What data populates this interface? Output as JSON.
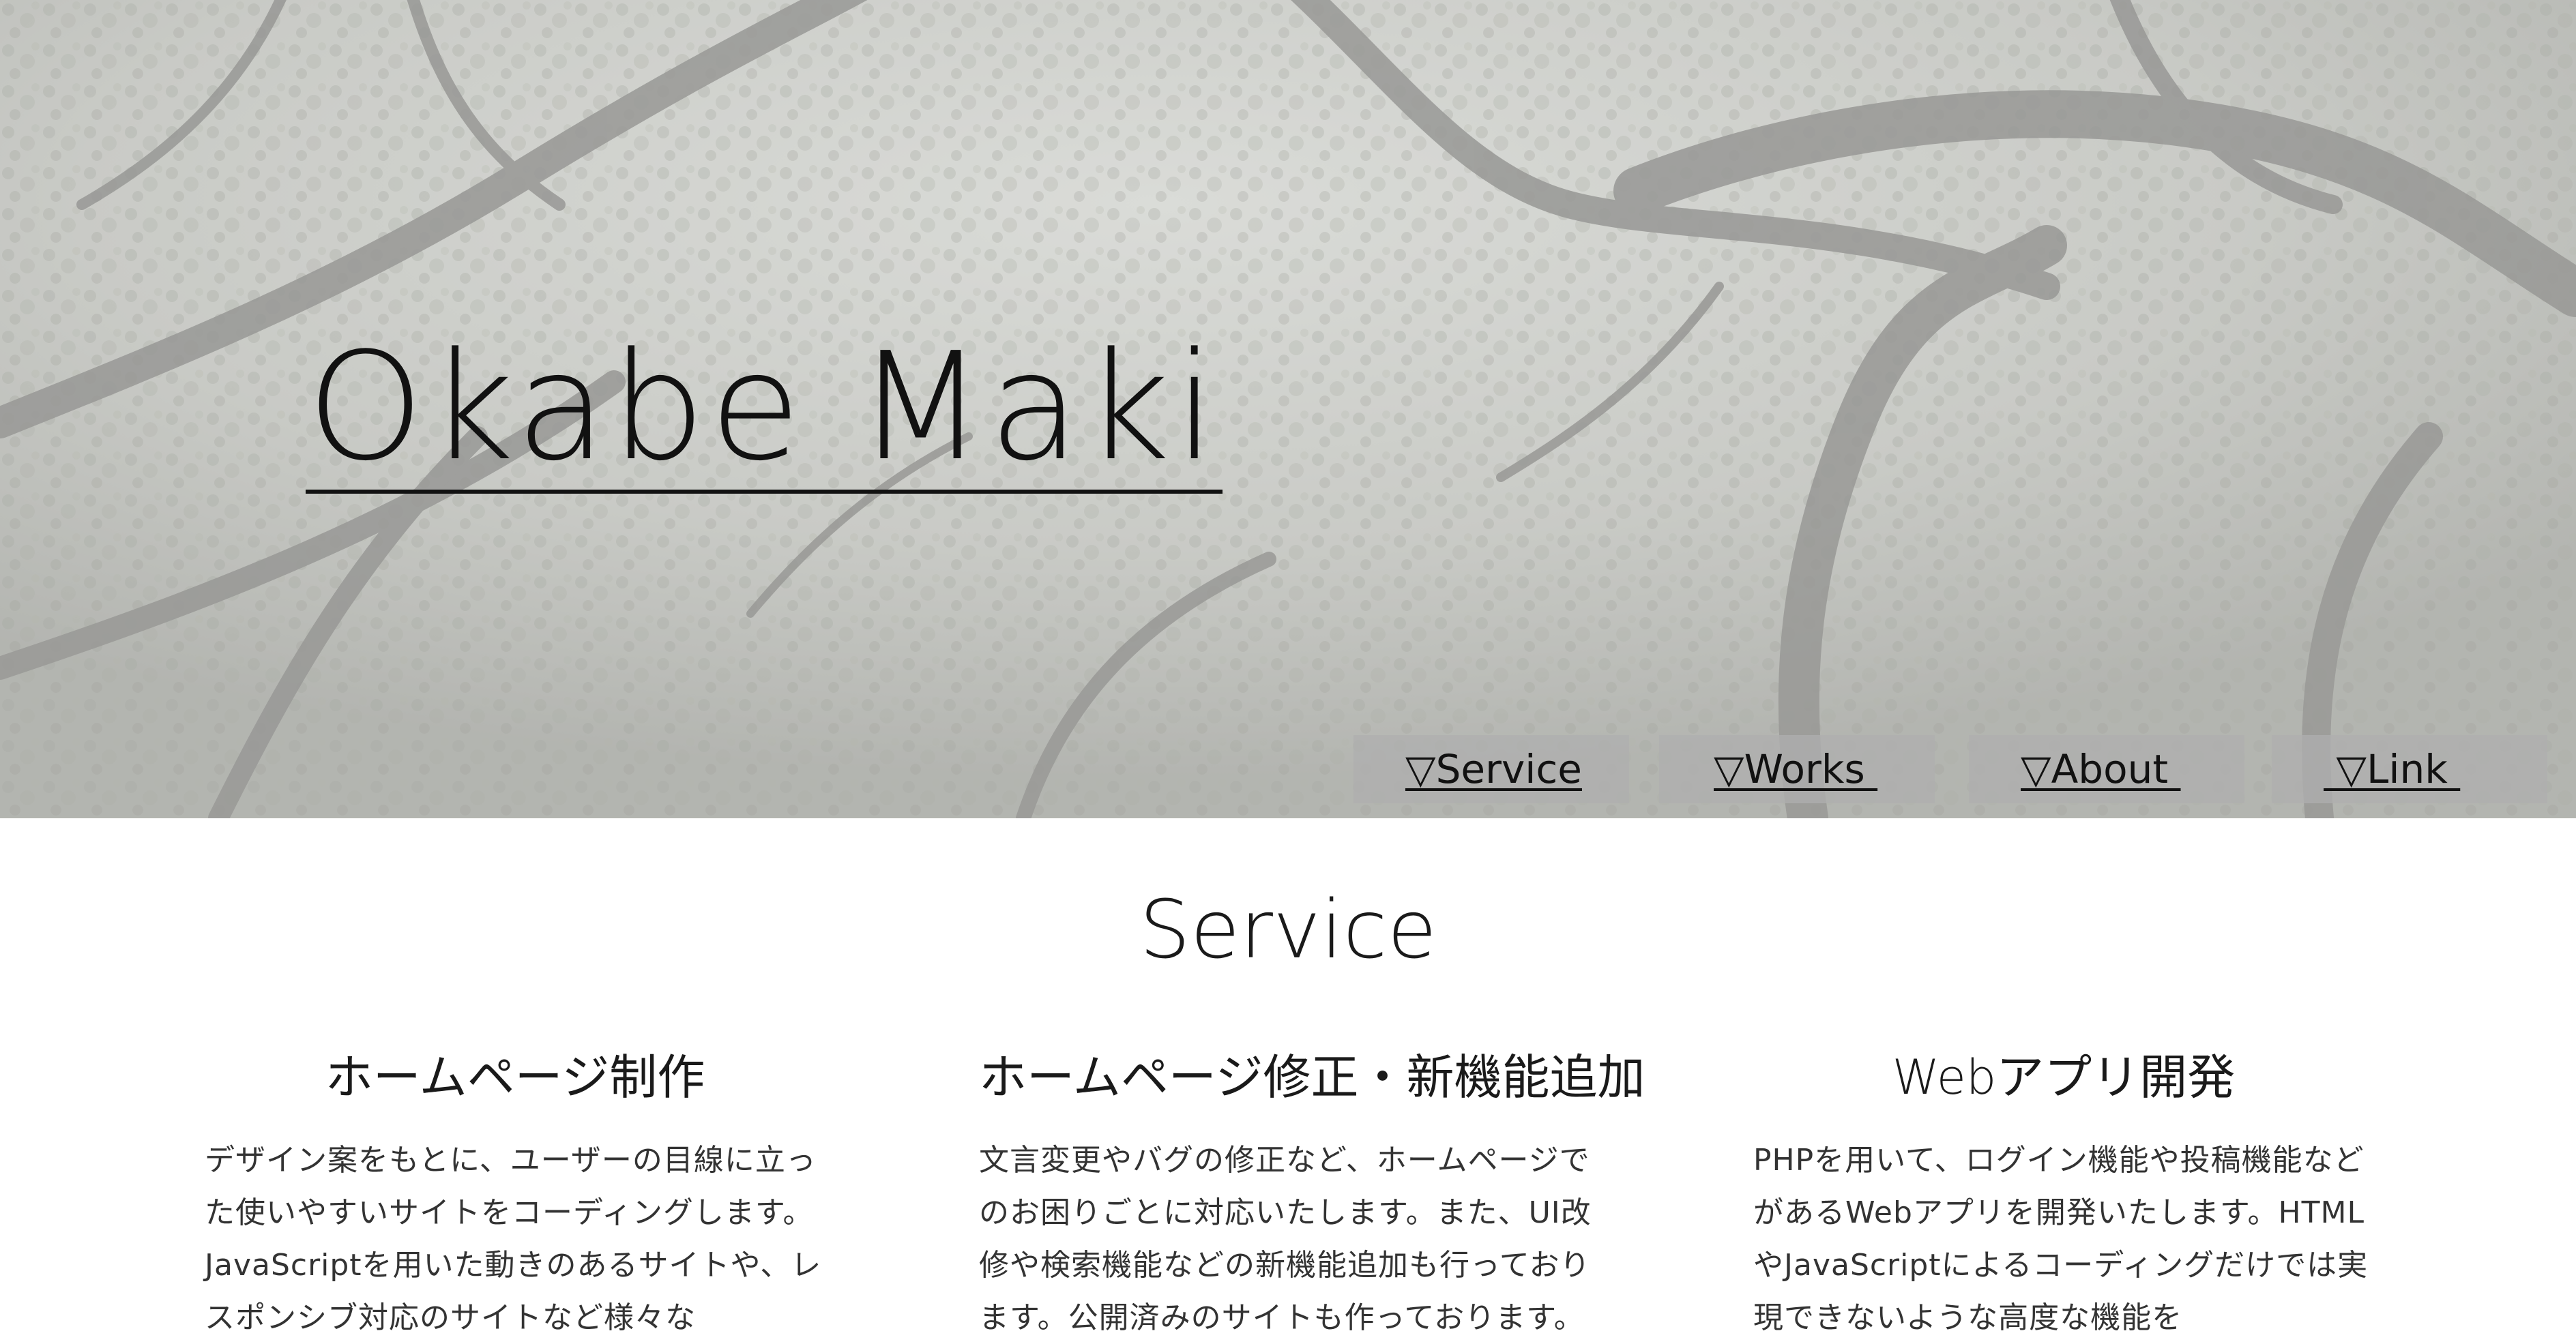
{
  "header": {
    "site_title": "Okabe Maki"
  },
  "nav": {
    "items": [
      {
        "label": "▽Service"
      },
      {
        "label": "▽Works "
      },
      {
        "label": "▽About "
      },
      {
        "label": " ▽Link "
      }
    ]
  },
  "service": {
    "heading": "Service",
    "items": [
      {
        "title": "ホームページ制作",
        "description": "デザイン案をもとに、ユーザーの目線に立った使いやすいサイトをコーディングします。JavaScriptを用いた動きのあるサイトや、レスポンシブ対応のサイトなど様々な"
      },
      {
        "title": "ホームページ修正・新機能追加",
        "description": "文言変更やバグの修正など、ホームページでのお困りごとに対応いたします。また、UI改修や検索機能などの新機能追加も行っております。公開済みのサイトも作っております。"
      },
      {
        "title": "Webアプリ開発",
        "description": "PHPを用いて、ログイン機能や投稿機能などがあるWebアプリを開発いたします。HTMLやJavaScriptによるコーディングだけでは実現できないような高度な機能を"
      }
    ]
  },
  "colors": {
    "hero_tint": "#bdbdbd",
    "text": "#1a1a1a",
    "nav_bg": "#afafaf"
  }
}
